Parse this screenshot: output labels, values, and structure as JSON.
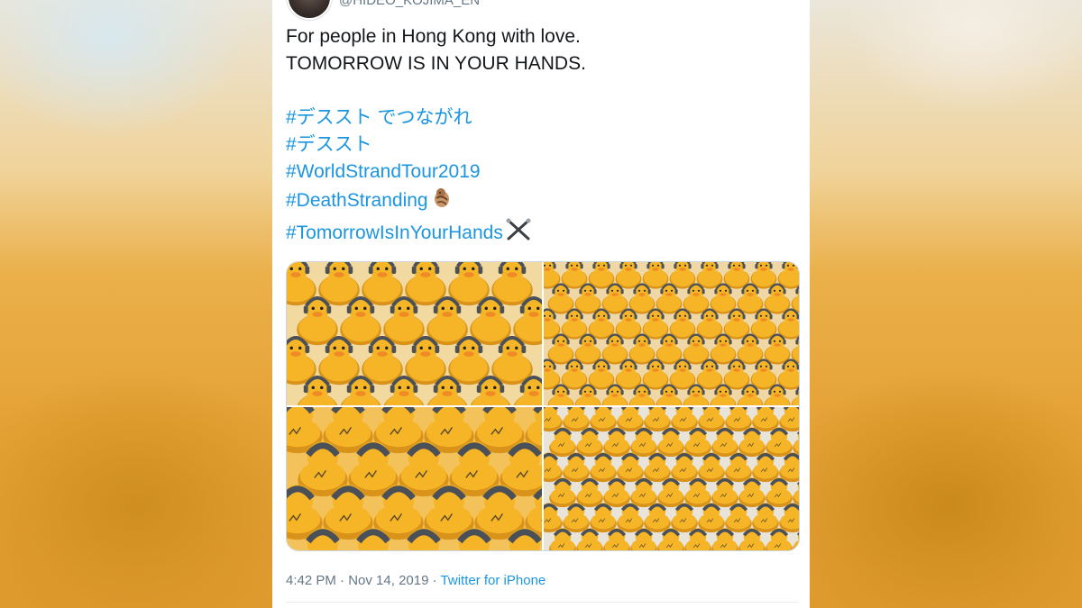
{
  "tweet": {
    "handle": "@HIDEO_KOJIMA_EN",
    "text_lines": [
      "For people in Hong Kong with love.",
      "TOMORROW IS IN YOUR HANDS."
    ],
    "hashtags": [
      "#デススト でつながれ",
      "#デススト",
      "#WorldStrandTour2019",
      "#DeathStranding",
      "#TomorrowIsInYourHands"
    ],
    "time": "4:42 PM",
    "separator1": "·",
    "date": "Nov 14, 2019",
    "separator2": "·",
    "source": "Twitter for iPhone"
  },
  "media": {
    "count": 4,
    "subject": "rubber duck",
    "colors": {
      "duck": "#f5b526",
      "duck_shadow": "#d9931a",
      "beak": "#f08a24",
      "headphone": "#4a5057"
    }
  },
  "colors": {
    "link": "#1b95e0",
    "text": "#14171a",
    "muted": "#657786",
    "border": "#ccd6dd"
  }
}
